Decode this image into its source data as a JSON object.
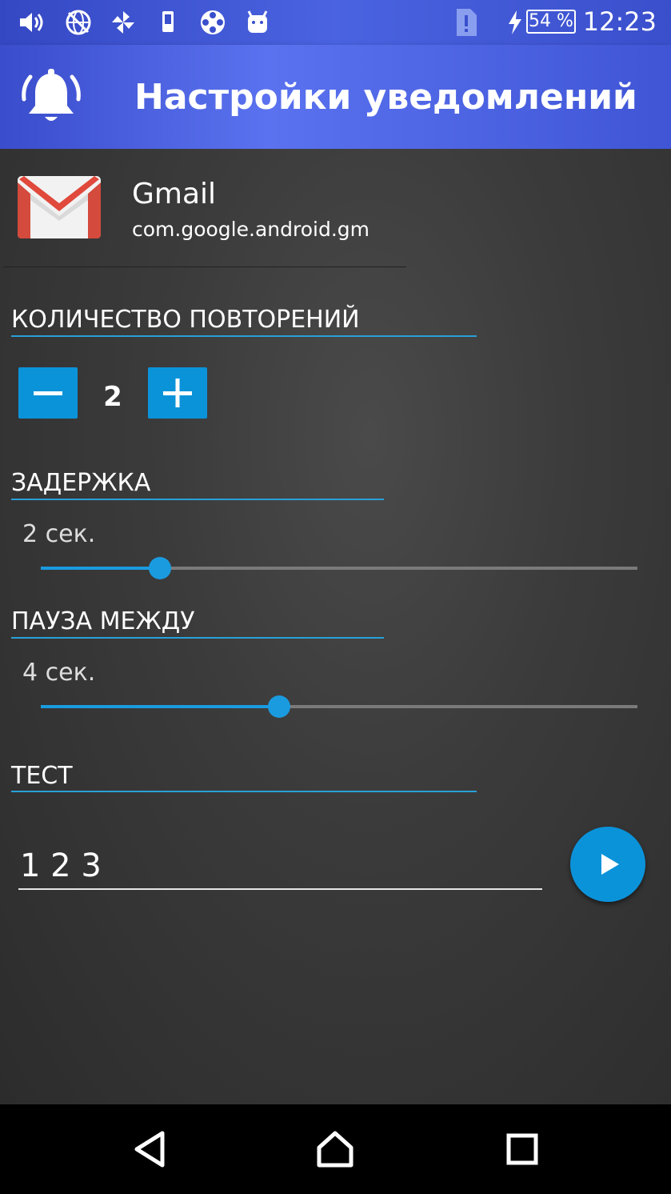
{
  "status_bar": {
    "time": "12:23",
    "battery": "54 %",
    "icons": [
      "volume-icon",
      "globe-off-icon",
      "pinwheel-icon",
      "phone-icon",
      "film-reel-icon",
      "android-icon",
      "alert-sim-icon",
      "charging-bolt-icon",
      "battery-icon"
    ]
  },
  "app_bar": {
    "title": "Настройки уведомлений",
    "icon": "bell-icon"
  },
  "app_info": {
    "name": "Gmail",
    "package": "com.google.android.gm"
  },
  "repeat": {
    "label": "КОЛИЧЕСТВО ПОВТОРЕНИЙ",
    "value": "2"
  },
  "delay": {
    "label": "ЗАДЕРЖКА",
    "value_text": "2 сек.",
    "slider_fraction": 0.2
  },
  "pause": {
    "label": "ПАУЗА МЕЖДУ",
    "value_text": "4 сек.",
    "slider_fraction": 0.4
  },
  "test": {
    "label": "ТЕСТ",
    "input_value": "1 2 3"
  },
  "colors": {
    "accent": "#0b93da",
    "app_bar": "#4a63e0"
  }
}
